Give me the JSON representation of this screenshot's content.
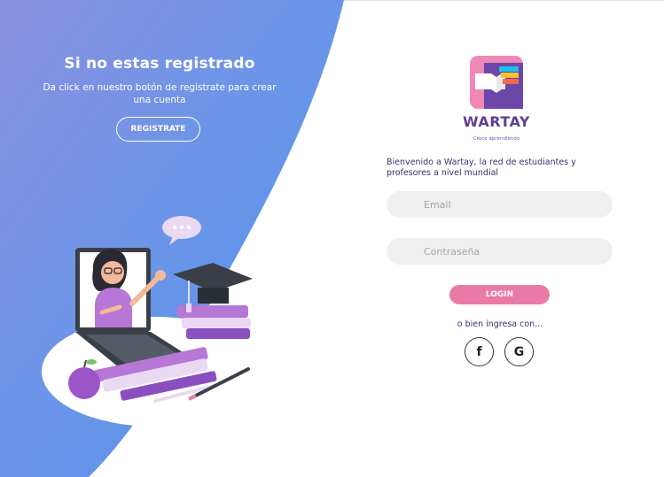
{
  "left_panel": {
    "title": "Si no estas registrado",
    "subtitle": "Da click en nuestro botón de registrate para crear una cuenta",
    "register_label": "REGISTRATE"
  },
  "brand": {
    "name": "WARTAY",
    "tagline": "Crece aprendiendo"
  },
  "login": {
    "welcome": "Bienvenido a Wartay, la red de estudiantes y profesores a nivel mundial",
    "email_placeholder": "Email",
    "password_placeholder": "Contraseña",
    "login_label": "LOGIN",
    "alt_text": "o bien ingresa con...",
    "facebook_glyph": "f",
    "google_glyph": "G"
  },
  "colors": {
    "panel_gradient_start": "#7f95e6",
    "panel_gradient_end": "#4f93ec",
    "brand_purple": "#5d3f95",
    "login_pink": "#e97aa6",
    "field_gray": "#efefef"
  }
}
